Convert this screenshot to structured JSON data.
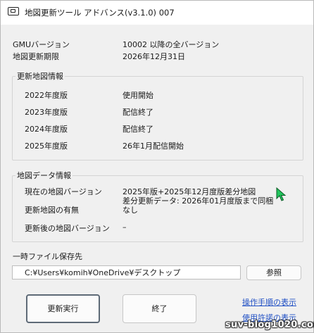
{
  "window": {
    "title": "地図更新ツール アドバンス(v3.1.0) 007"
  },
  "info": {
    "gmu_label": "GMUバージョン",
    "gmu_value": "10002 以降の全バージョン",
    "deadline_label": "地図更新期限",
    "deadline_value": "2026年12月31日"
  },
  "update_map_info": {
    "title": "更新地図情報",
    "rows": [
      {
        "year": "2022年度版",
        "status": "使用開始"
      },
      {
        "year": "2023年度版",
        "status": "配信終了"
      },
      {
        "year": "2024年度版",
        "status": "配信終了"
      },
      {
        "year": "2025年度版",
        "status": "26年1月配信開始"
      }
    ]
  },
  "map_data_info": {
    "title": "地図データ情報",
    "current_label": "現在の地図バージョン",
    "current_value_line1": "2025年版+2025年12月度版差分地図",
    "current_value_line2": "差分更新データ: 2026年01月度版まで同梱",
    "availability_label": "更新地図の有無",
    "availability_value": "なし",
    "after_label": "更新後の地図バージョン",
    "after_value": "–"
  },
  "temp": {
    "label": "一時ファイル保存先",
    "path": "C:¥Users¥komih¥OneDrive¥デスクトップ",
    "browse_label": "参照"
  },
  "actions": {
    "run_label": "更新実行",
    "end_label": "終了",
    "procedure_link": "操作手順の表示",
    "license_link": "使用許諾の表示"
  },
  "watermark": "suv-blog1020.com",
  "colors": {
    "link": "#1f4fc4",
    "cursor_fill": "#22c55e",
    "primary_border": "#5e6a77"
  }
}
